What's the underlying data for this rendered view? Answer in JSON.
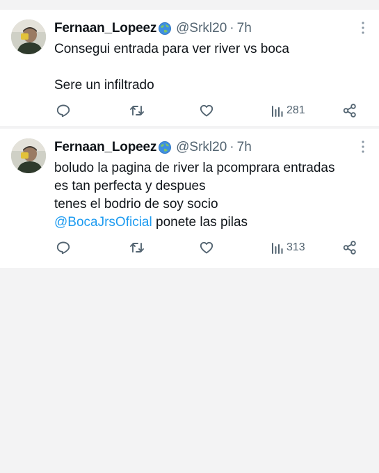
{
  "tweets": [
    {
      "display_name": "Fernaan_Lopeez",
      "handle": "@Srkl20",
      "separator": "·",
      "time": "7h",
      "lines": [
        "Consegui entrada para ver river vs boca",
        "",
        "Sere un infiltrado"
      ],
      "views": "281",
      "icons": [
        "reply-icon",
        "retweet-icon",
        "like-icon",
        "views-icon",
        "share-icon",
        "more-icon",
        "globe-icon"
      ]
    },
    {
      "display_name": "Fernaan_Lopeez",
      "handle": "@Srkl20",
      "separator": "·",
      "time": "7h",
      "lines": [
        "boludo la pagina de river la pcomprara entradas",
        "es tan perfecta y despues",
        "tenes el bodrio de soy socio"
      ],
      "mention": "@BocaJrsOficial",
      "mention_tail": " ponete las pilas",
      "views": "313",
      "icons": [
        "reply-icon",
        "retweet-icon",
        "like-icon",
        "views-icon",
        "share-icon",
        "more-icon",
        "globe-icon"
      ]
    }
  ],
  "colors": {
    "text": "#0f1419",
    "secondary": "#536471",
    "mention": "#1d9bf0",
    "background": "#f3f3f4",
    "card": "#ffffff"
  }
}
